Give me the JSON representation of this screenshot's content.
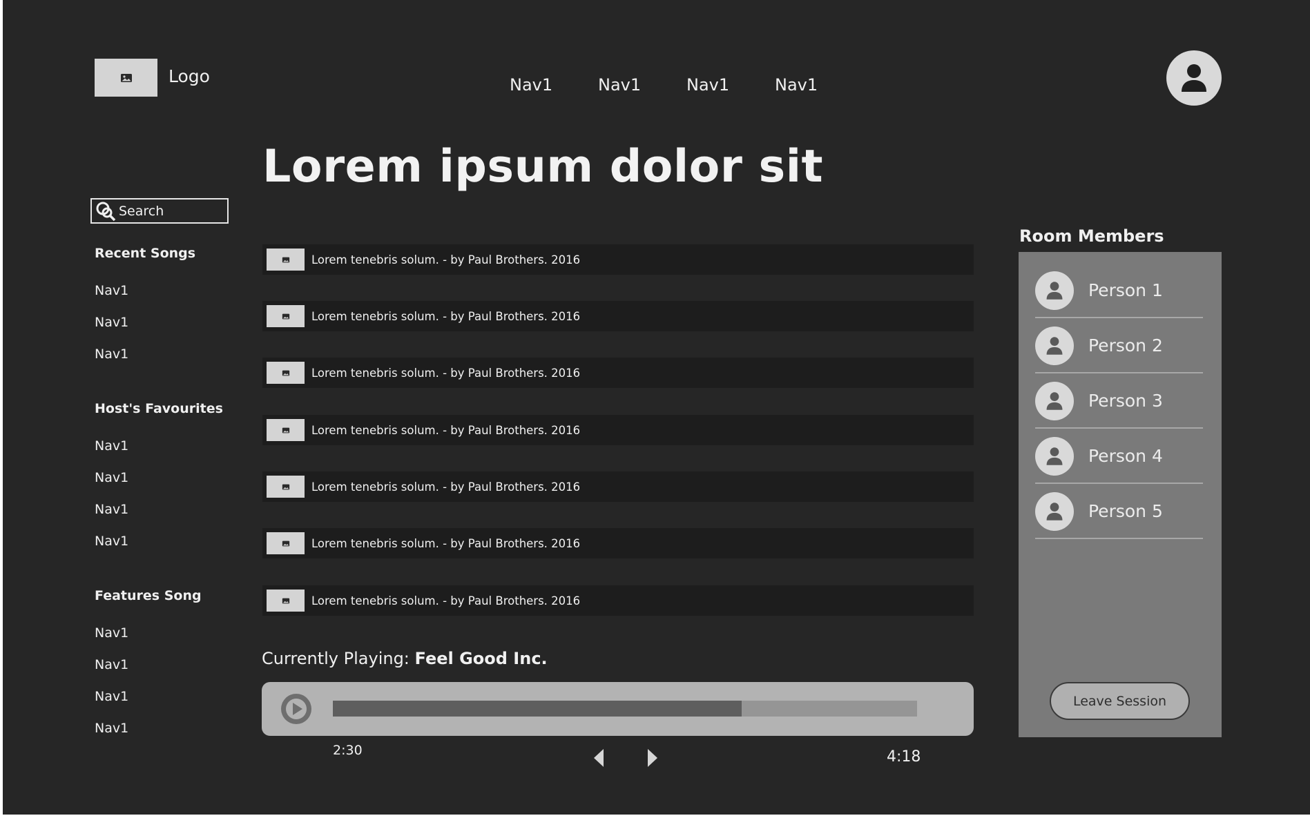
{
  "header": {
    "logo_label": "Logo",
    "logo_icon": "image-icon",
    "nav": [
      "Nav1",
      "Nav1",
      "Nav1",
      "Nav1"
    ],
    "profile_icon": "user-icon"
  },
  "main": {
    "title": "Lorem ipsum dolor sit",
    "songs": [
      "Lorem tenebris solum. - by Paul Brothers. 2016",
      "Lorem tenebris solum. - by Paul Brothers. 2016",
      "Lorem tenebris solum. - by Paul Brothers. 2016",
      "Lorem tenebris solum. - by Paul Brothers. 2016",
      "Lorem tenebris solum. - by Paul Brothers. 2016",
      "Lorem tenebris solum. - by Paul Brothers. 2016",
      "Lorem tenebris solum. - by Paul Brothers. 2016"
    ]
  },
  "sidebar": {
    "search_placeholder": "Search",
    "sections": [
      {
        "heading": "Recent Songs",
        "items": [
          "Nav1",
          "Nav1",
          "Nav1"
        ]
      },
      {
        "heading": "Host's Favourites",
        "items": [
          "Nav1",
          "Nav1",
          "Nav1",
          "Nav1"
        ]
      },
      {
        "heading": "Features Song",
        "items": [
          "Nav1",
          "Nav1",
          "Nav1",
          "Nav1"
        ]
      }
    ]
  },
  "player": {
    "label": "Currently Playing:",
    "track": "Feel Good Inc.",
    "current_time": "2:30",
    "total_time": "4:18",
    "progress_fraction": 0.7
  },
  "members": {
    "title": "Room Members",
    "people": [
      "Person 1",
      "Person 2",
      "Person 3",
      "Person 4",
      "Person 5"
    ],
    "leave_label": "Leave Session"
  },
  "colors": {
    "background": "#262626",
    "row": "#1d1d1d",
    "panel": "#7a7a7a",
    "player": "#b3b3b3"
  }
}
